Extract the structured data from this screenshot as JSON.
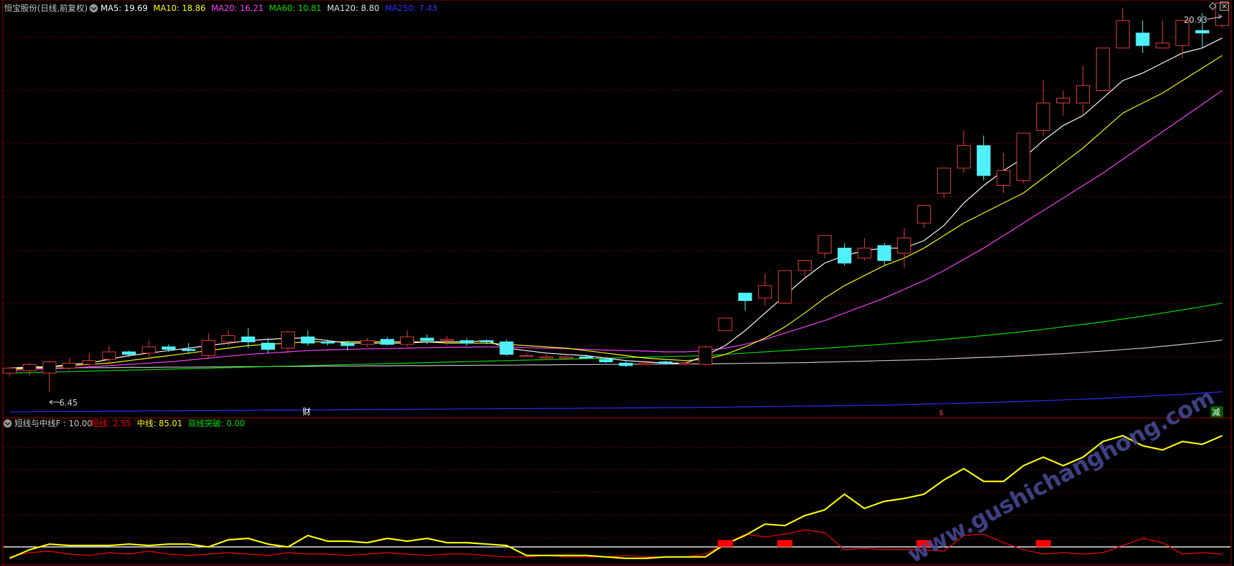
{
  "colors": {
    "background": "#000000",
    "frame": "#a00000",
    "grid": "#7a0000",
    "up": "#e8403a",
    "down": "#50f0f8",
    "ma5": "#ffffff",
    "ma10": "#ffff00",
    "ma20": "#ff40ff",
    "ma60": "#00e000",
    "ma120": "#c8c8c8",
    "ma250": "#3030ff",
    "short": "#ff0000",
    "mid": "#ffff00",
    "dual": "#00e000",
    "baseline": "#ffffff",
    "watermark": "#5050a0"
  },
  "main_legend": {
    "title": "恒宝股份(日线,前复权)",
    "items": [
      {
        "text": "MA5: 19.69",
        "color": "#ffffff"
      },
      {
        "text": "MA10: 18.86",
        "color": "#ffff00"
      },
      {
        "text": "MA20: 16.21",
        "color": "#ff40ff"
      },
      {
        "text": "MA60: 10.81",
        "color": "#00e000"
      },
      {
        "text": "MA120: 8.80",
        "color": "#e0e0e0"
      },
      {
        "text": "MA250: 7.43",
        "color": "#3030ff"
      }
    ]
  },
  "indicator_legend": {
    "title": "短线与中线F : 10.00",
    "items": [
      {
        "text": "短线: 2.55",
        "color": "#ff0000"
      },
      {
        "text": "中线: 85.01",
        "color": "#ffff00"
      },
      {
        "text": "双线突破: 0.00",
        "color": "#00e000"
      }
    ]
  },
  "annotations": {
    "high_label": "20.93",
    "low_label": "6.45",
    "marker_cai": "财",
    "marker_s": "s",
    "marker_jian": "减",
    "watermark": "www.gushichanghong.com"
  },
  "chart_data": [
    {
      "type": "candlestick",
      "ylim": [
        5.6,
        21.9
      ],
      "grid": true,
      "candles": [
        [
          7.2,
          7.4,
          7.05,
          7.45
        ],
        [
          7.3,
          7.55,
          7.1,
          7.6
        ],
        [
          7.2,
          7.65,
          6.45,
          7.7
        ],
        [
          7.4,
          7.6,
          7.3,
          7.8
        ],
        [
          7.55,
          7.7,
          7.4,
          8.0
        ],
        [
          7.75,
          8.05,
          7.6,
          8.3
        ],
        [
          8.05,
          7.95,
          7.85,
          8.1
        ],
        [
          8.0,
          8.25,
          7.85,
          8.5
        ],
        [
          8.25,
          8.15,
          8.05,
          8.35
        ],
        [
          8.15,
          8.1,
          7.95,
          8.4
        ],
        [
          7.9,
          8.5,
          7.8,
          8.8
        ],
        [
          8.45,
          8.7,
          8.3,
          8.9
        ],
        [
          8.65,
          8.45,
          8.2,
          9.0
        ],
        [
          8.4,
          8.15,
          8.0,
          8.6
        ],
        [
          8.2,
          8.85,
          8.0,
          8.9
        ],
        [
          8.65,
          8.4,
          8.3,
          8.9
        ],
        [
          8.45,
          8.4,
          8.3,
          8.55
        ],
        [
          8.4,
          8.3,
          8.1,
          8.5
        ],
        [
          8.35,
          8.5,
          8.25,
          8.6
        ],
        [
          8.55,
          8.35,
          8.3,
          8.65
        ],
        [
          8.35,
          8.65,
          8.25,
          8.9
        ],
        [
          8.6,
          8.5,
          8.35,
          8.75
        ],
        [
          8.55,
          8.55,
          8.3,
          8.7
        ],
        [
          8.5,
          8.4,
          8.3,
          8.6
        ],
        [
          8.5,
          8.45,
          8.35,
          8.55
        ],
        [
          8.45,
          7.95,
          7.9,
          8.55
        ],
        [
          7.9,
          7.9,
          7.85,
          8.0
        ],
        [
          7.8,
          7.85,
          7.75,
          7.95
        ],
        [
          7.8,
          7.85,
          7.75,
          7.95
        ],
        [
          7.85,
          7.8,
          7.75,
          7.95
        ],
        [
          7.75,
          7.65,
          7.6,
          7.85
        ],
        [
          7.6,
          7.5,
          7.45,
          7.7
        ],
        [
          7.55,
          7.6,
          7.5,
          7.7
        ],
        [
          7.65,
          7.6,
          7.55,
          7.7
        ],
        [
          7.55,
          7.6,
          7.5,
          7.7
        ],
        [
          7.55,
          8.25,
          7.5,
          8.3
        ],
        [
          8.9,
          9.4,
          8.9,
          9.4
        ],
        [
          10.4,
          10.1,
          9.7,
          10.4
        ],
        [
          10.2,
          10.7,
          9.9,
          11.2
        ],
        [
          10.0,
          11.3,
          10.0,
          11.3
        ],
        [
          11.3,
          11.7,
          11.0,
          11.7
        ],
        [
          12.0,
          12.7,
          11.8,
          12.7
        ],
        [
          12.2,
          11.6,
          11.5,
          12.4
        ],
        [
          11.8,
          12.2,
          11.7,
          12.6
        ],
        [
          12.3,
          11.7,
          11.5,
          12.4
        ],
        [
          12.0,
          12.6,
          11.4,
          13.0
        ],
        [
          13.2,
          13.9,
          13.0,
          13.9
        ],
        [
          14.4,
          15.4,
          14.2,
          15.4
        ],
        [
          15.4,
          16.3,
          15.2,
          16.9
        ],
        [
          16.3,
          15.1,
          14.9,
          16.7
        ],
        [
          14.7,
          15.3,
          14.4,
          16.0
        ],
        [
          14.9,
          16.8,
          14.8,
          16.8
        ],
        [
          16.9,
          18.0,
          16.7,
          18.9
        ],
        [
          18.0,
          18.2,
          17.5,
          18.5
        ],
        [
          18.0,
          18.7,
          17.5,
          19.5
        ],
        [
          18.5,
          20.2,
          18.5,
          20.2
        ],
        [
          20.2,
          21.3,
          20.2,
          21.8
        ],
        [
          20.8,
          20.3,
          20.0,
          21.3
        ],
        [
          20.2,
          20.4,
          20.2,
          21.3
        ],
        [
          20.3,
          21.3,
          19.8,
          21.3
        ],
        [
          20.9,
          20.8,
          20.2,
          21.6
        ],
        [
          21.1,
          22.0,
          21.0,
          22.0
        ]
      ],
      "ma5": [
        7.4,
        7.45,
        7.45,
        7.55,
        7.6,
        7.75,
        7.9,
        8.0,
        8.1,
        8.2,
        8.3,
        8.4,
        8.5,
        8.55,
        8.6,
        8.6,
        8.5,
        8.4,
        8.4,
        8.4,
        8.4,
        8.45,
        8.45,
        8.45,
        8.5,
        8.2,
        8.1,
        8.0,
        7.95,
        7.9,
        7.8,
        7.7,
        7.65,
        7.6,
        7.6,
        7.9,
        8.3,
        8.9,
        9.6,
        10.3,
        11.0,
        11.6,
        11.9,
        12.1,
        12.2,
        12.2,
        12.5,
        13.1,
        14.0,
        14.7,
        15.3,
        15.8,
        16.5,
        17.1,
        17.5,
        18.2,
        18.9,
        19.2,
        19.6,
        20.0,
        20.2,
        20.6
      ],
      "ma10": [
        7.35,
        7.4,
        7.45,
        7.5,
        7.55,
        7.6,
        7.7,
        7.8,
        7.9,
        8.0,
        8.1,
        8.2,
        8.3,
        8.35,
        8.4,
        8.45,
        8.45,
        8.45,
        8.45,
        8.45,
        8.45,
        8.45,
        8.4,
        8.4,
        8.4,
        8.35,
        8.3,
        8.25,
        8.2,
        8.1,
        8.0,
        7.9,
        7.8,
        7.75,
        7.7,
        7.75,
        7.95,
        8.25,
        8.6,
        9.05,
        9.6,
        10.2,
        10.7,
        11.1,
        11.5,
        11.8,
        12.2,
        12.7,
        13.2,
        13.6,
        14.0,
        14.4,
        15.0,
        15.6,
        16.2,
        16.9,
        17.6,
        18.0,
        18.4,
        18.9,
        19.4,
        19.9
      ],
      "ma20": [
        7.3,
        7.35,
        7.38,
        7.4,
        7.45,
        7.5,
        7.55,
        7.6,
        7.65,
        7.72,
        7.8,
        7.88,
        7.95,
        8.0,
        8.05,
        8.1,
        8.13,
        8.15,
        8.17,
        8.18,
        8.2,
        8.22,
        8.23,
        8.24,
        8.25,
        8.24,
        8.22,
        8.2,
        8.18,
        8.15,
        8.12,
        8.1,
        8.08,
        8.05,
        8.05,
        8.1,
        8.2,
        8.35,
        8.55,
        8.8,
        9.05,
        9.3,
        9.6,
        9.9,
        10.2,
        10.55,
        10.9,
        11.3,
        11.75,
        12.2,
        12.7,
        13.2,
        13.7,
        14.2,
        14.7,
        15.2,
        15.75,
        16.3,
        16.85,
        17.4,
        17.95,
        18.5
      ],
      "ma60": [
        7.2,
        7.22,
        7.24,
        7.26,
        7.28,
        7.3,
        7.32,
        7.34,
        7.36,
        7.38,
        7.4,
        7.42,
        7.44,
        7.46,
        7.48,
        7.5,
        7.52,
        7.54,
        7.56,
        7.58,
        7.6,
        7.62,
        7.64,
        7.66,
        7.68,
        7.7,
        7.72,
        7.74,
        7.76,
        7.78,
        7.8,
        7.82,
        7.84,
        7.86,
        7.88,
        7.9,
        7.95,
        8.0,
        8.05,
        8.1,
        8.15,
        8.2,
        8.25,
        8.3,
        8.36,
        8.42,
        8.48,
        8.55,
        8.62,
        8.7,
        8.78,
        8.86,
        8.95,
        9.05,
        9.15,
        9.25,
        9.36,
        9.48,
        9.6,
        9.73,
        9.86,
        10.0
      ],
      "ma120": [
        7.4,
        7.4,
        7.41,
        7.41,
        7.42,
        7.42,
        7.43,
        7.43,
        7.44,
        7.44,
        7.45,
        7.45,
        7.46,
        7.46,
        7.47,
        7.47,
        7.48,
        7.48,
        7.49,
        7.49,
        7.5,
        7.5,
        7.51,
        7.51,
        7.52,
        7.52,
        7.53,
        7.53,
        7.54,
        7.54,
        7.55,
        7.55,
        7.56,
        7.56,
        7.57,
        7.57,
        7.58,
        7.59,
        7.6,
        7.61,
        7.62,
        7.64,
        7.66,
        7.68,
        7.7,
        7.72,
        7.74,
        7.77,
        7.8,
        7.83,
        7.86,
        7.9,
        7.94,
        7.98,
        8.03,
        8.08,
        8.14,
        8.2,
        8.27,
        8.35,
        8.43,
        8.52
      ],
      "ma250": [
        5.65,
        5.66,
        5.66,
        5.67,
        5.67,
        5.68,
        5.68,
        5.69,
        5.69,
        5.7,
        5.7,
        5.71,
        5.71,
        5.72,
        5.72,
        5.73,
        5.73,
        5.74,
        5.74,
        5.75,
        5.75,
        5.76,
        5.76,
        5.77,
        5.77,
        5.78,
        5.78,
        5.79,
        5.79,
        5.8,
        5.8,
        5.81,
        5.81,
        5.82,
        5.82,
        5.83,
        5.84,
        5.85,
        5.86,
        5.87,
        5.88,
        5.89,
        5.9,
        5.91,
        5.92,
        5.94,
        5.96,
        5.98,
        6.0,
        6.02,
        6.04,
        6.07,
        6.1,
        6.13,
        6.16,
        6.19,
        6.23,
        6.27,
        6.31,
        6.35,
        6.4,
        6.46
      ]
    },
    {
      "type": "line",
      "ylim": [
        0,
        100
      ],
      "reference_line": 10,
      "series": [
        {
          "name": "短线",
          "values": [
            3,
            6,
            7,
            5,
            4,
            6,
            5,
            7,
            5,
            4,
            5,
            6,
            5,
            4,
            6,
            5,
            5,
            4,
            5,
            6,
            5,
            4,
            5,
            5,
            4,
            3,
            3,
            4,
            3,
            3,
            3,
            4,
            3,
            3,
            3,
            5,
            12,
            19,
            17,
            19,
            22,
            20,
            8,
            9,
            8,
            8,
            8,
            7,
            18,
            19,
            13,
            8,
            5,
            6,
            5,
            6,
            11,
            16,
            13,
            5,
            6,
            5
          ]
        },
        {
          "name": "中线",
          "values": [
            2,
            8,
            12,
            11,
            11,
            11,
            12,
            11,
            12,
            12,
            10,
            15,
            16,
            12,
            10,
            18,
            14,
            14,
            13,
            16,
            14,
            16,
            13,
            13,
            12,
            11,
            4,
            4,
            4,
            4,
            3,
            2,
            2,
            3,
            3,
            3,
            12,
            18,
            26,
            25,
            32,
            36,
            47,
            37,
            42,
            44,
            47,
            57,
            65,
            56,
            56,
            67,
            73,
            67,
            73,
            84,
            88,
            81,
            78,
            84,
            82,
            88
          ]
        }
      ]
    }
  ]
}
